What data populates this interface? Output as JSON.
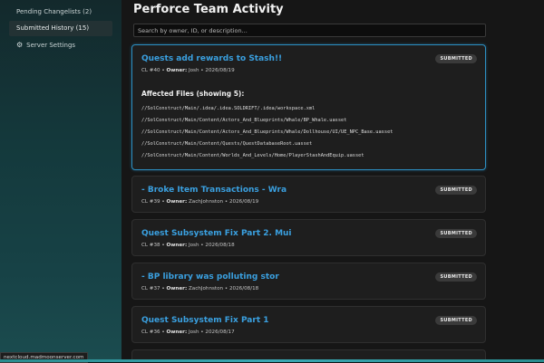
{
  "sidebar": {
    "items": [
      {
        "label": "Pending Changelists (2)",
        "icon": ""
      },
      {
        "label": "Submitted History (15)",
        "icon": "",
        "active": true
      },
      {
        "label": "Server Settings",
        "icon": "gear-icon"
      }
    ]
  },
  "page": {
    "title": "Perforce Team Activity"
  },
  "search": {
    "placeholder": "Search by owner, ID, or description..."
  },
  "changelists": [
    {
      "title": "Quests add rewards to Stash!!",
      "cl": "CL #40",
      "owner_label": "Owner:",
      "owner": "Josh",
      "date": "2026/08/19",
      "badge": "SUBMITTED",
      "files_heading": "Affected Files (showing 5):",
      "files": [
        "//SolConstruct/Main/.idea/.idea.SOLDRIFT/.idea/workspace.xml",
        "//SolConstruct/Main/Content/Actors_And_Blueprints/Whale/BP_Whale.uasset",
        "//SolConstruct/Main/Content/Actors_And_Blueprints/Whale/Dollhouse/UI/UE_NPC_Base.uasset",
        "//SolConstruct/Main/Content/Quests/QuestDatabaseRoot.uasset",
        "//SolConstruct/Main/Content/Worlds_And_Levels/Home/PlayerStashAndEquip.uasset"
      ]
    },
    {
      "title": "- Broke Item Transactions - Wra",
      "cl": "CL #39",
      "owner_label": "Owner:",
      "owner": "ZachJohnston",
      "date": "2026/08/19",
      "badge": "SUBMITTED"
    },
    {
      "title": "Quest Subsystem Fix Part 2. Mui",
      "cl": "CL #38",
      "owner_label": "Owner:",
      "owner": "Josh",
      "date": "2026/08/18",
      "badge": "SUBMITTED"
    },
    {
      "title": "- BP library was polluting stor",
      "cl": "CL #37",
      "owner_label": "Owner:",
      "owner": "ZachJohnston",
      "date": "2026/08/18",
      "badge": "SUBMITTED"
    },
    {
      "title": "Quest Subsystem Fix Part 1",
      "cl": "CL #36",
      "owner_label": "Owner:",
      "owner": "Josh",
      "date": "2026/08/17",
      "badge": "SUBMITTED"
    }
  ],
  "meta_separator": "•",
  "status_bar": {
    "url": "nextcloud.madmoonserver.com"
  },
  "colors": {
    "accent_blue": "#3aa0e0",
    "card_border_active": "#2c8fc2",
    "badge_bg": "#3a3a3a"
  }
}
